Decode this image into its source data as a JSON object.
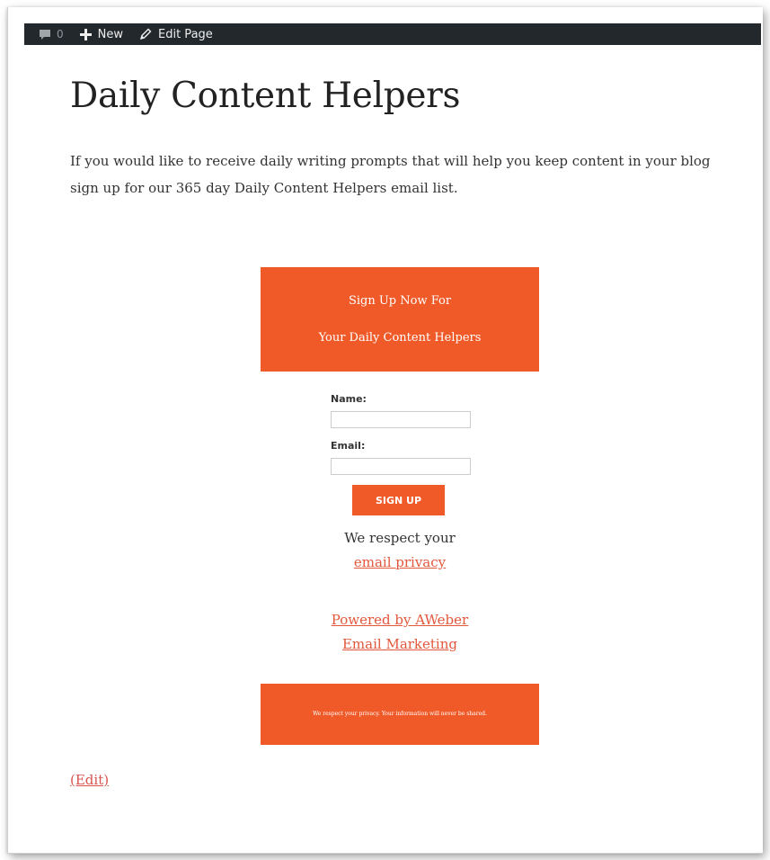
{
  "admin_bar": {
    "comments_count": "0",
    "new_label": "New",
    "edit_page_label": "Edit Page"
  },
  "page": {
    "title": "Daily Content Helpers",
    "intro": "If you would like to receive daily writing prompts that will help you keep content in your blog sign up for our 365 day Daily Content Helpers email list.",
    "edit_link": "(Edit)"
  },
  "signup_form": {
    "header_line1": "Sign Up Now For",
    "header_line2": "Your Daily Content Helpers",
    "name_label": "Name:",
    "name_value": "",
    "email_label": "Email:",
    "email_value": "",
    "submit_label": "SIGN UP",
    "privacy_intro": "We respect your",
    "privacy_link": "email privacy",
    "powered_by_line1": "Powered by AWeber",
    "powered_by_line2": "Email Marketing",
    "footer_note": "We respect your privacy. Your information will never be shared."
  },
  "colors": {
    "admin_bar_bg": "#23282d",
    "accent": "#f05a28",
    "link": "#e2573b"
  }
}
